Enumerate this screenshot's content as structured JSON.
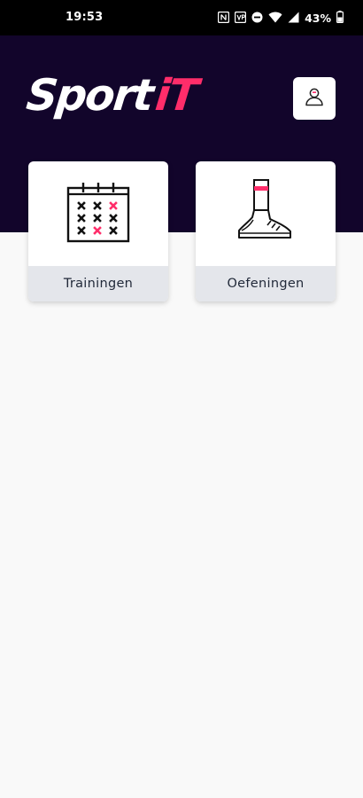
{
  "status_bar": {
    "time": "19:53",
    "battery": "43%",
    "icons": [
      "nfc-icon",
      "vpn-icon",
      "do-not-disturb-icon",
      "wifi-icon",
      "signal-icon",
      "battery-icon"
    ]
  },
  "header": {
    "logo_part1": "Sport",
    "logo_part2": "iT",
    "profile_icon": "user-profile-icon"
  },
  "tiles": [
    {
      "label": "Trainingen",
      "icon": "calendar-grid-icon"
    },
    {
      "label": "Oefeningen",
      "icon": "sneaker-icon"
    }
  ],
  "colors": {
    "header_bg": "#12052b",
    "accent": "#ff2d6a",
    "background": "#f9f9f9",
    "tile_label_bg": "#e4e6eb"
  }
}
